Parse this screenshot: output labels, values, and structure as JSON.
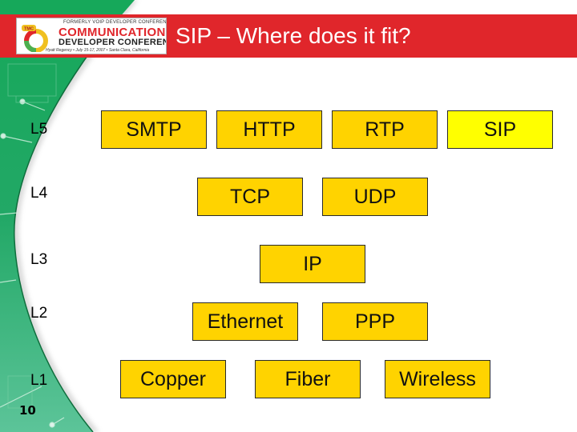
{
  "slide": {
    "title": "SIP – Where does it fit?",
    "slide_number": "10",
    "colors": {
      "title_band": "#e0262b",
      "title_text": "#ffffff",
      "protocol_box": "#ffd300",
      "highlight_box": "#ffff00",
      "background_green": "#1ea463"
    }
  },
  "logo": {
    "tagline": "FORMERLY VOIP DEVELOPER CONFERENCE",
    "line1": "COMMUNICATIONS",
    "line2": "DEVELOPER CONFERENCE",
    "venue": "Hyatt Regency • July 15-17, 2007 • Santa Clara, California",
    "badge": "TMC"
  },
  "layers": [
    {
      "label": "L5"
    },
    {
      "label": "L4"
    },
    {
      "label": "L3"
    },
    {
      "label": "L2"
    },
    {
      "label": "L1"
    }
  ],
  "protocols": {
    "l5": [
      {
        "label": "SMTP",
        "highlight": false
      },
      {
        "label": "HTTP",
        "highlight": false
      },
      {
        "label": "RTP",
        "highlight": false
      },
      {
        "label": "SIP",
        "highlight": true
      }
    ],
    "l4": [
      {
        "label": "TCP",
        "highlight": false
      },
      {
        "label": "UDP",
        "highlight": false
      }
    ],
    "l3": [
      {
        "label": "IP",
        "highlight": false
      }
    ],
    "l2": [
      {
        "label": "Ethernet",
        "highlight": false
      },
      {
        "label": "PPP",
        "highlight": false
      }
    ],
    "l1": [
      {
        "label": "Copper",
        "highlight": false
      },
      {
        "label": "Fiber",
        "highlight": false
      },
      {
        "label": "Wireless",
        "highlight": false
      }
    ]
  }
}
